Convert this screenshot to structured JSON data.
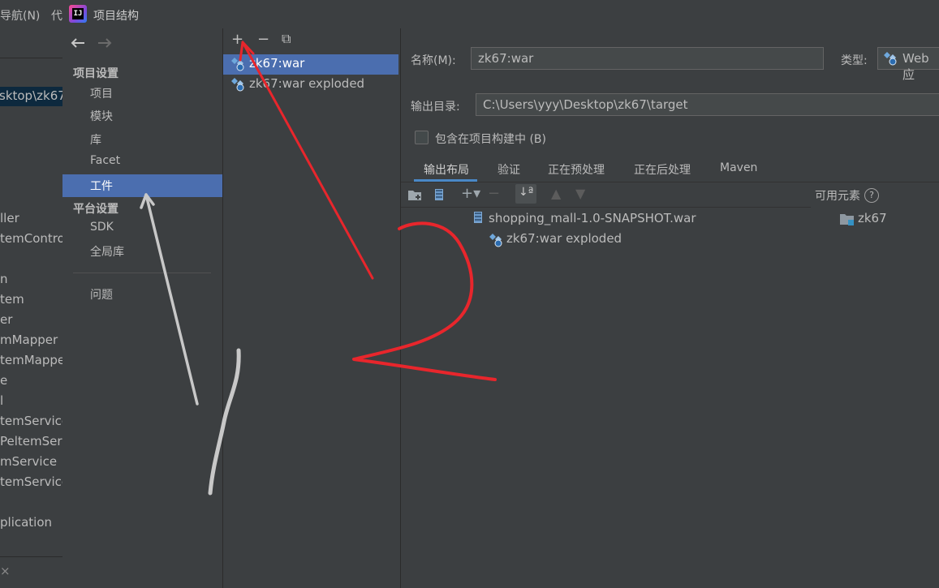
{
  "titlebar": {
    "menu_navigate": "导航(N)",
    "menu_code": "代",
    "dialog_title": "项目结构"
  },
  "bg_tree": {
    "items": [
      "sktop\\zk67",
      "ller",
      "temContro",
      "n",
      "tem",
      "er",
      "mMapper",
      "temMappe",
      "e",
      "l",
      "temService",
      "PeltemServ",
      "mService",
      "temService",
      "plication"
    ],
    "close_glyph": "×"
  },
  "nav": {
    "back_icon": "back-arrow-icon",
    "forward_icon": "forward-arrow-icon",
    "project_settings": "项目设置",
    "items": [
      "项目",
      "模块",
      "库",
      "Facet",
      "工件"
    ],
    "platform_settings": "平台设置",
    "platform_items": [
      "SDK",
      "全局库"
    ],
    "problems": "问题",
    "selected": "工件"
  },
  "artifacts": {
    "toolbar": {
      "add": "+",
      "remove": "−",
      "copy": "⧉"
    },
    "items": [
      "zk67:war",
      "zk67:war exploded"
    ],
    "selected": "zk67:war"
  },
  "detail": {
    "name_label": "名称(M):",
    "name_value": "zk67:war",
    "type_label": "类型:",
    "type_value": "Web 应",
    "output_label": "输出目录:",
    "output_value": "C:\\Users\\yyy\\Desktop\\zk67\\target",
    "include_label": "包含在项目构建中 (B)",
    "include_checked": false,
    "tabs": [
      "输出布局",
      "验证",
      "正在预处理",
      "正在后处理",
      "Maven"
    ],
    "active_tab": "输出布局",
    "available_label": "可用元素",
    "help_glyph": "?",
    "layout_tree": [
      "shopping_mall-1.0-SNAPSHOT.war",
      "zk67:war exploded"
    ],
    "available_items": [
      "zk67"
    ]
  },
  "colors": {
    "background": "#3c3f41",
    "selection": "#4b6eaf",
    "annotation_red": "#e8262c",
    "annotation_gray": "#c8c8c8"
  }
}
